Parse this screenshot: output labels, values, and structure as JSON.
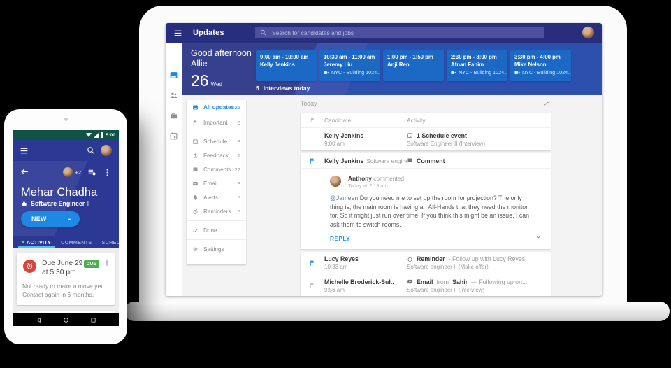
{
  "laptop": {
    "topbar": {
      "title": "Updates",
      "search_placeholder": "Search for candidates and jobs"
    },
    "header": {
      "greeting_line1": "Good afternoon",
      "greeting_line2": "Allie",
      "date_day": "26",
      "date_weekday": "Wed",
      "interviews_count": "5",
      "interviews_label": "Interviews today",
      "interviews": [
        {
          "time": "9:00 am - 10:00 am",
          "name": "Kelly Jenkins",
          "location": ""
        },
        {
          "time": "10:30 am - 11:00 am",
          "name": "Jeremy Liu",
          "location": "NYC - Building 1024..."
        },
        {
          "time": "1:00 pm - 1:50 pm",
          "name": "Anji Ren",
          "location": ""
        },
        {
          "time": "2:30 pm - 3:00 pm",
          "name": "Afnan Fahim",
          "location": "NYC - Building 1024..."
        },
        {
          "time": "3:30 pm - 4:00 pm",
          "name": "Mike Nelson",
          "location": "NYC - Building 1024..."
        }
      ]
    },
    "sidebar": {
      "items": [
        {
          "label": "All updates",
          "count": "25"
        },
        {
          "label": "Important",
          "count": "6"
        },
        {
          "label": "Schedule",
          "count": "3"
        },
        {
          "label": "Feedback",
          "count": "1"
        },
        {
          "label": "Comments",
          "count": "22"
        },
        {
          "label": "Email",
          "count": "8"
        },
        {
          "label": "Alerts",
          "count": "5"
        },
        {
          "label": "Reminders",
          "count": "5"
        },
        {
          "label": "Done",
          "count": ""
        },
        {
          "label": "Settings",
          "count": ""
        }
      ]
    },
    "main": {
      "section_title": "Today",
      "columns": {
        "candidate": "Candidate",
        "activity": "Activity"
      },
      "rows": [
        {
          "name": "Kelly Jenkins",
          "time": "9:00 am",
          "activity_title": "1 Schedule event",
          "activity_sub": "Software Engineer II (Interview)"
        },
        {
          "name": "Kelly Jenkins",
          "name_sub": "Software engine...",
          "activity_title": "Comment"
        },
        {
          "name": "Lucy Reyes",
          "time": "10:33 am",
          "activity_bold": "Reminder",
          "activity_rest": "- Follow up with Lucy Reyes",
          "activity_sub": "Software engineer II (Make offer)"
        },
        {
          "name": "Michelle Broderick-Sul..",
          "time": "9:56 am",
          "activity_bold": "Email",
          "activity_mid": "from",
          "activity_bold2": "Sahir",
          "activity_rest": "— Following up on...",
          "activity_sub": "Software engineer II (Interview)"
        }
      ],
      "comment": {
        "author": "Anthony",
        "action": "commented",
        "timestamp": "Today at 7:13 am",
        "mention": "@Jameen",
        "body": "Do you need me to set up the room for projection? The only thing is, the main room is having an All-Hands that they need the monitor for. So it might just run over time. If you think this might be an issue, I can ask them to switch rooms.",
        "reply_label": "REPLY"
      }
    }
  },
  "phone": {
    "status_time": "5:00",
    "profile": {
      "avatar_extra": "+2",
      "name": "Mehar Chadha",
      "job_title": "Software Engineer II",
      "stage_button": "NEW"
    },
    "tabs": [
      "ACTIVITY",
      "COMMENTS",
      "SCHEDULE"
    ],
    "card": {
      "due_text": "Due June 29 at 5:30 pm",
      "badge": "DUE",
      "body": "Not ready to make a move yet. Contact again in 6 months."
    }
  },
  "colors": {
    "accent_blue": "#1e88e5",
    "topbar_indigo": "#272e7e",
    "header_indigo": "#36408d",
    "header_blue": "#2d4fae",
    "interview_card_blue": "#1b69c4",
    "flag_blue": "#2196f3",
    "due_green": "#4caf50",
    "alarm_red": "#d9453d",
    "status_bar_green": "#0f5347",
    "phone_indigo": "#2b3994",
    "tab_underline": "#4fc3f7",
    "tab_dot_green": "#7cd622"
  }
}
